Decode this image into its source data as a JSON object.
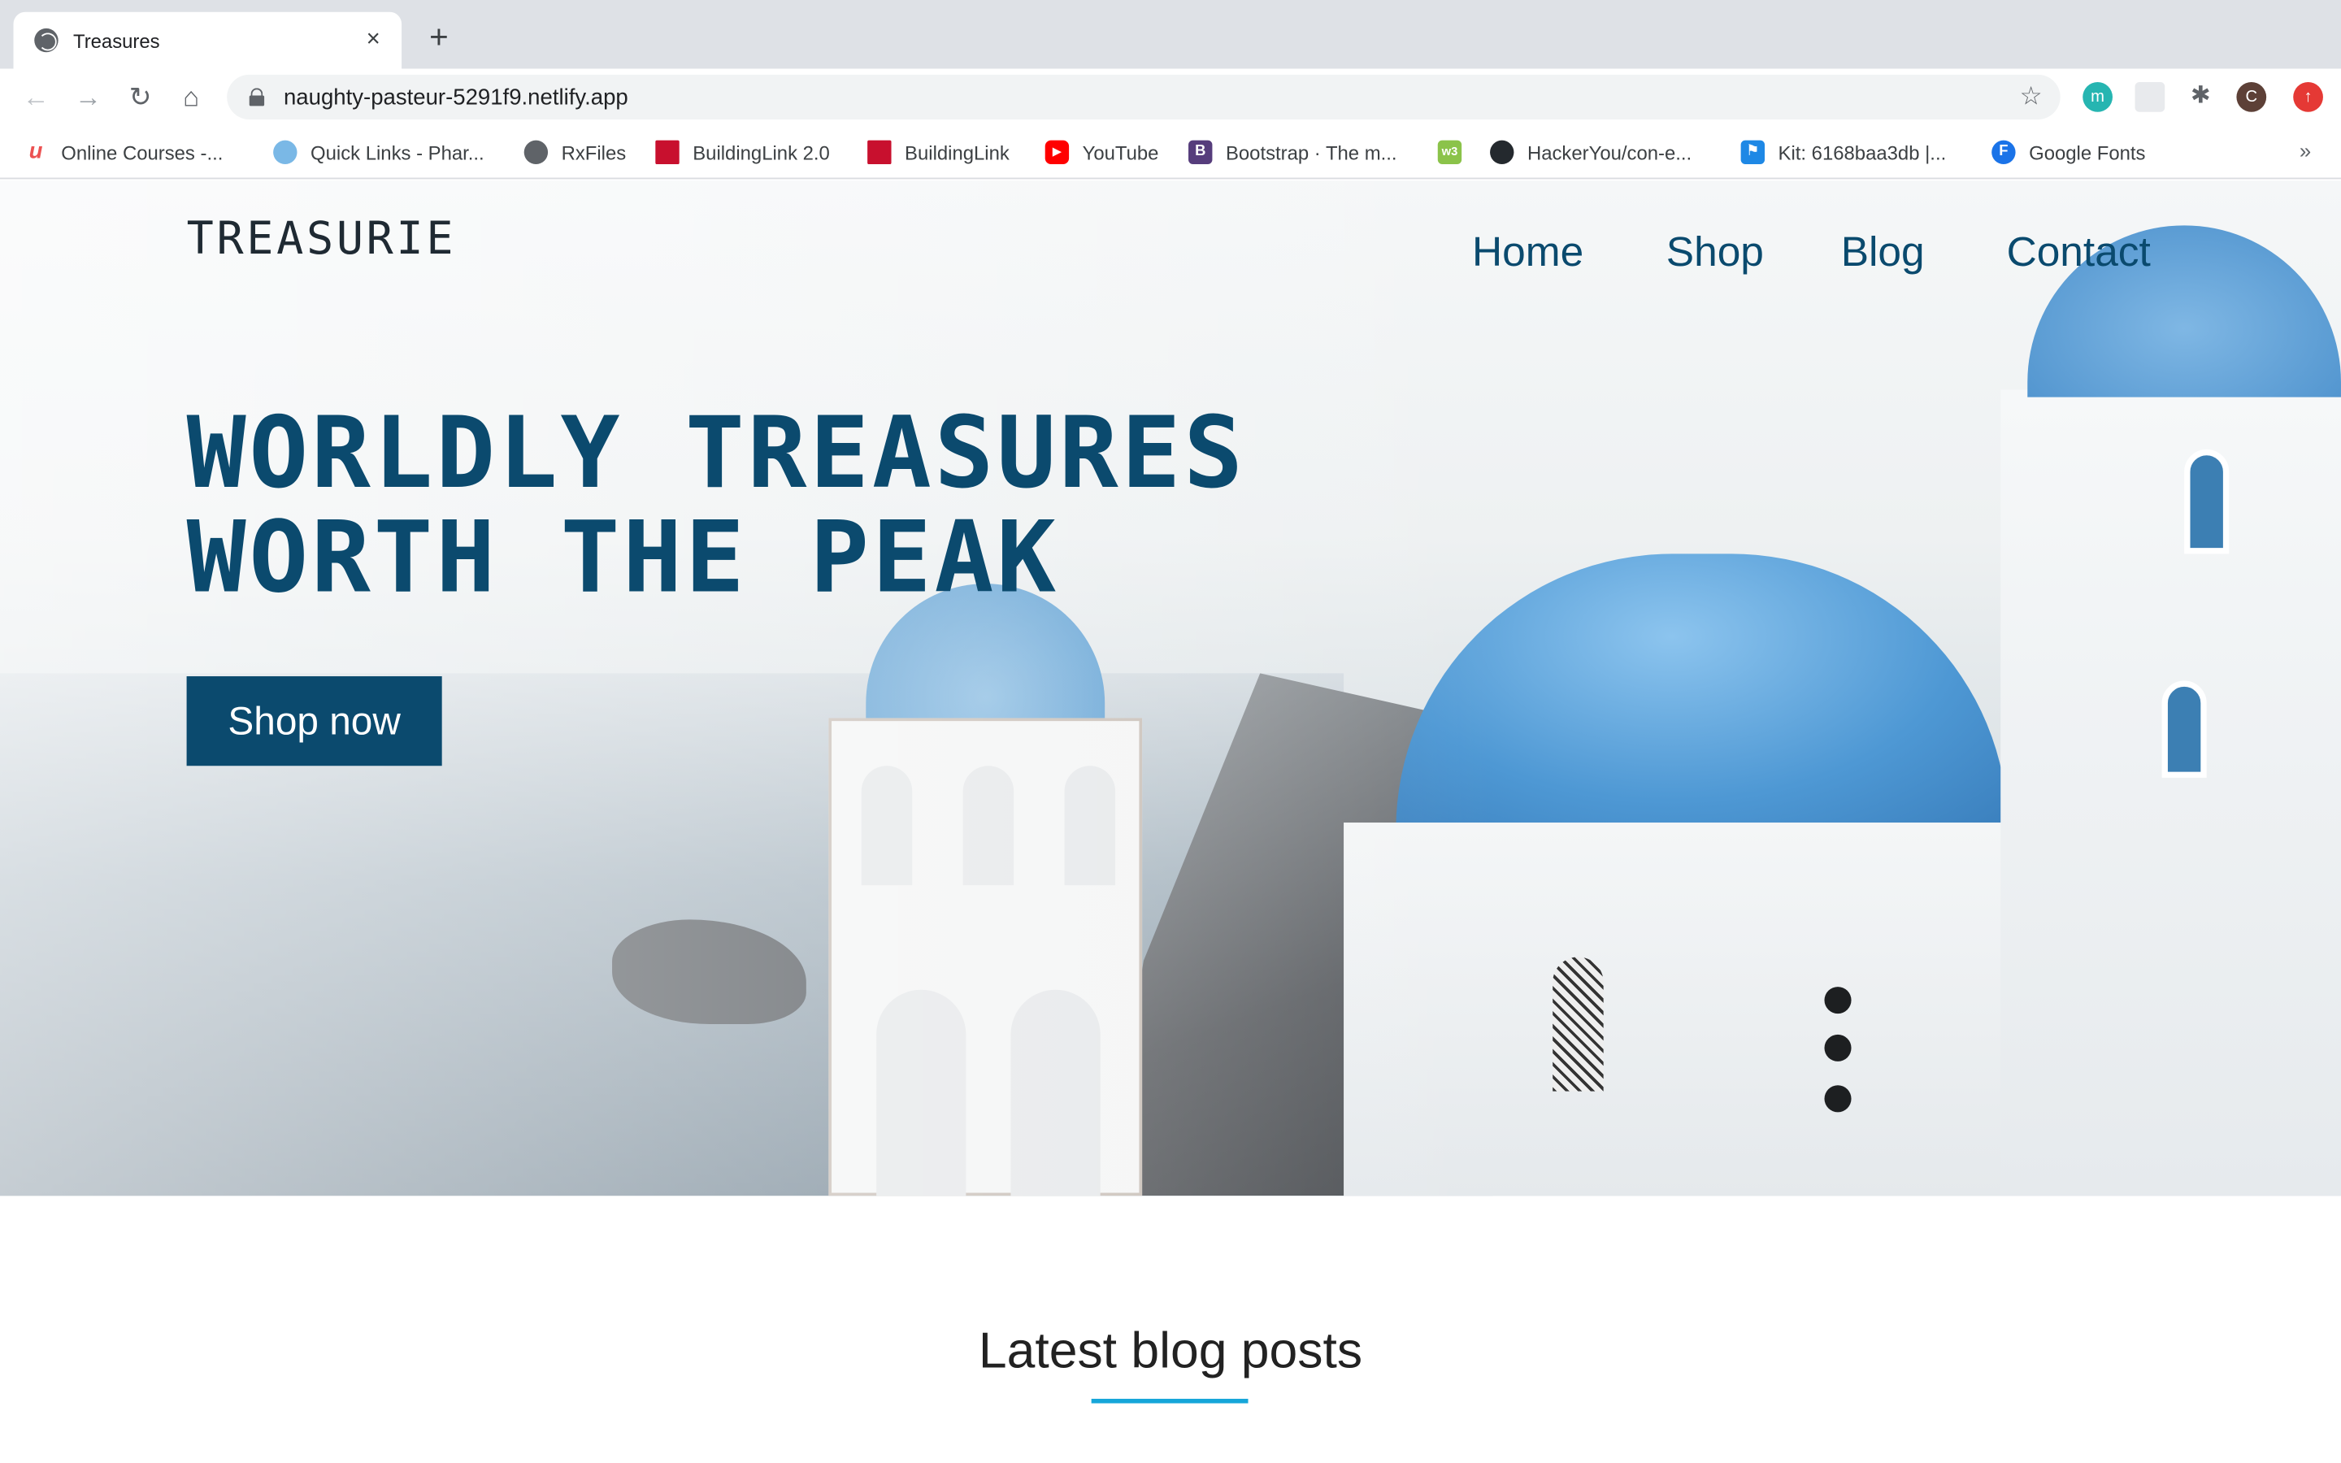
{
  "browser": {
    "tab_title": "Treasures",
    "tab_close": "×",
    "new_tab": "+",
    "url": "naughty-pasteur-5291f9.netlify.app",
    "profile_initial": "C",
    "extension_m": "m",
    "bookmarks": [
      {
        "label": "Online Courses -...",
        "icon": "udemy-icon",
        "color": "#ec5252",
        "glyph": "u"
      },
      {
        "label": "Quick Links - Phar...",
        "icon": "cloud-icon",
        "color": "#7ab8e6",
        "glyph": ""
      },
      {
        "label": "RxFiles",
        "icon": "globe-icon",
        "color": "#5f6368",
        "glyph": ""
      },
      {
        "label": "BuildingLink 2.0",
        "icon": "buildinglink-icon",
        "color": "#c8102e",
        "glyph": ""
      },
      {
        "label": "BuildingLink",
        "icon": "buildinglink-icon",
        "color": "#c8102e",
        "glyph": ""
      },
      {
        "label": "YouTube",
        "icon": "youtube-icon",
        "color": "#ff0000",
        "glyph": "▶"
      },
      {
        "label": "Bootstrap · The m...",
        "icon": "bootstrap-icon",
        "color": "#563d7c",
        "glyph": "B"
      },
      {
        "label": "",
        "icon": "w3-icon",
        "color": "#8bc34a",
        "glyph": "w3"
      },
      {
        "label": "HackerYou/con-e...",
        "icon": "github-icon",
        "color": "#24292e",
        "glyph": ""
      },
      {
        "label": "Kit: 6168baa3db |...",
        "icon": "flag-icon",
        "color": "#1e88e5",
        "glyph": "⚑"
      },
      {
        "label": "Google Fonts",
        "icon": "google-fonts-icon",
        "color": "#1a73e8",
        "glyph": "F"
      }
    ],
    "bookmarks_more": "»"
  },
  "site": {
    "logo": "TREASURIE",
    "nav": [
      "Home",
      "Shop",
      "Blog",
      "Contact"
    ],
    "headline_line1": "WORLDLY TREASURES",
    "headline_line2": "WORTH THE PEAK",
    "cta": "Shop now",
    "section_title": "Latest blog posts"
  },
  "colors": {
    "brand": "#0b4a6e",
    "accent_underline": "#16a6d9"
  }
}
